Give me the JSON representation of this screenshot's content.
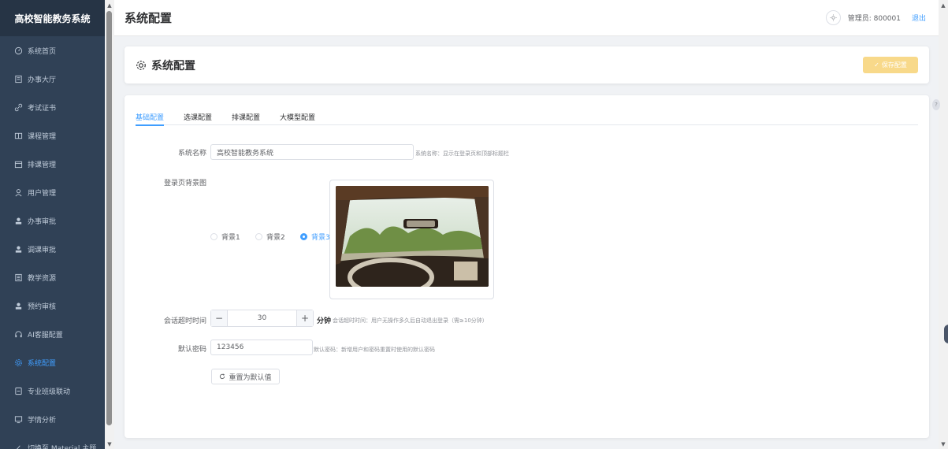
{
  "app": {
    "logo_text": "高校智能教务系统"
  },
  "sidebar": {
    "items": [
      {
        "label": "系统首页",
        "icon": "odometer-icon"
      },
      {
        "label": "办事大厅",
        "icon": "office-building-icon"
      },
      {
        "label": "考试证书",
        "icon": "link-icon"
      },
      {
        "label": "课程管理",
        "icon": "reading-icon"
      },
      {
        "label": "排课管理",
        "icon": "calendar-icon"
      },
      {
        "label": "用户管理",
        "icon": "user-icon"
      },
      {
        "label": "办事审批",
        "icon": "user-solid-icon"
      },
      {
        "label": "调课审批",
        "icon": "user-solid-icon"
      },
      {
        "label": "教学资源",
        "icon": "notebook-icon"
      },
      {
        "label": "预约审核",
        "icon": "user-solid-icon"
      },
      {
        "label": "AI客服配置",
        "icon": "headset-icon"
      },
      {
        "label": "系统配置",
        "icon": "setting-icon",
        "active": true
      },
      {
        "label": "专业班级联动",
        "icon": "document-icon"
      },
      {
        "label": "学情分析",
        "icon": "data-analysis-icon"
      },
      {
        "label": "切换至 Material 主题",
        "icon": "brush-icon"
      }
    ]
  },
  "header": {
    "title": "系统配置",
    "admin_label": "管理员: 800001",
    "logout_label": "退出"
  },
  "title_card": {
    "title": "系统配置",
    "save_label": "保存配置"
  },
  "tabs": [
    {
      "label": "基础配置",
      "active": true
    },
    {
      "label": "选课配置",
      "active": false
    },
    {
      "label": "排课配置",
      "active": false
    },
    {
      "label": "大模型配置",
      "active": false
    }
  ],
  "form": {
    "system_name": {
      "label": "系统名称",
      "value": "高校智能教务系统",
      "hint": "系统名称：显示在登录页和顶部标题栏"
    },
    "login_bg": {
      "label": "登录页背景图",
      "options": [
        "背景1",
        "背景2",
        "背景3"
      ],
      "selected": "背景3"
    },
    "session_timeout": {
      "label": "会话超时时间",
      "value": "30",
      "minus": "−",
      "plus": "+",
      "unit": "分钟",
      "hint": "会话超时时间：用户无操作多久后自动退出登录（需≥10分钟）"
    },
    "default_password": {
      "label": "默认密码",
      "value": "123456",
      "hint": "默认密码：新增用户和密码重置时使用的默认密码"
    },
    "reset_label": "重置为默认值"
  },
  "colors": {
    "primary": "#409eff",
    "sidebar_bg": "#304156",
    "logo_bg": "#263445",
    "save_button": "#f8d98a"
  }
}
